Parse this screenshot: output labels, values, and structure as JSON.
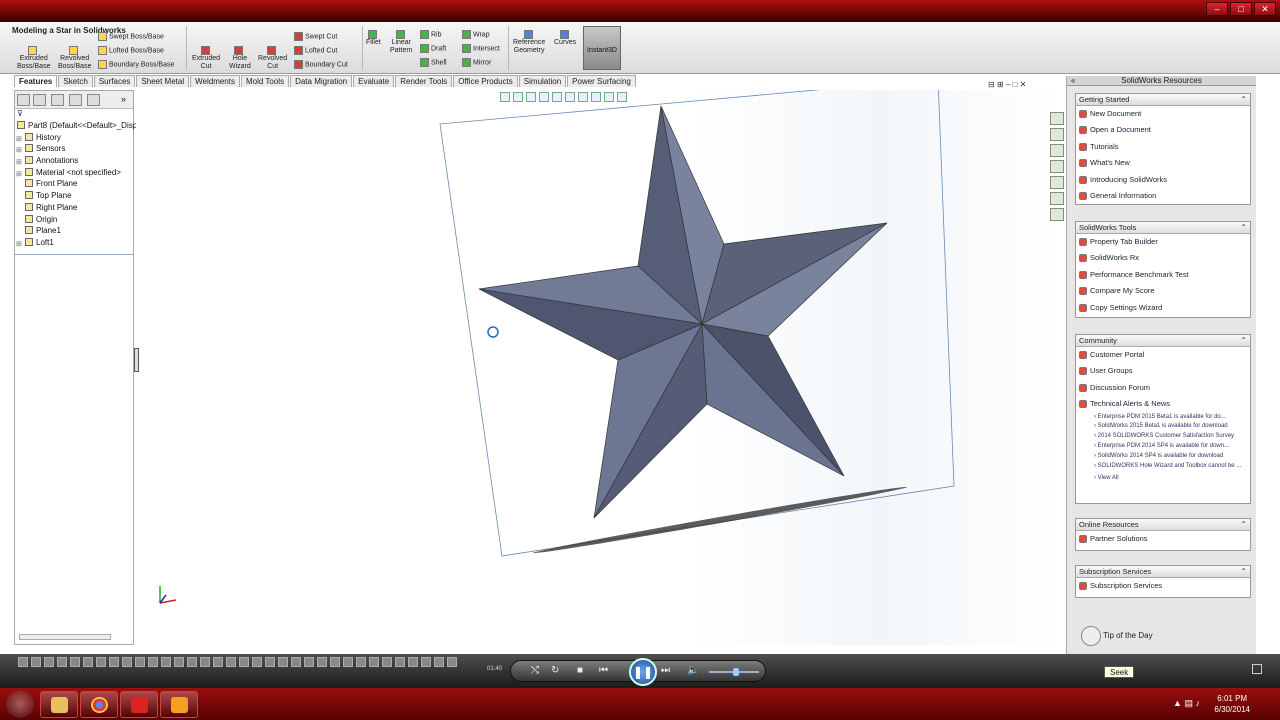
{
  "window": {
    "title": "Modeling a Star in Solidworks",
    "controls": [
      "–",
      "□",
      "✕"
    ]
  },
  "ribbon": {
    "extruded_boss": "Extruded\nBoss/Base",
    "revolved_boss": "Revolved\nBoss/Base",
    "swept_boss": "Swept Boss/Base",
    "lofted_boss": "Lofted Boss/Base",
    "boundary_boss": "Boundary Boss/Base",
    "extruded_cut": "Extruded\nCut",
    "hole_wizard": "Hole\nWizard",
    "revolved_cut": "Revolved\nCut",
    "swept_cut": "Swept Cut",
    "lofted_cut": "Lofted Cut",
    "boundary_cut": "Boundary Cut",
    "fillet": "Fillet",
    "linear_pattern": "Linear\nPattern",
    "rib": "Rib",
    "draft": "Draft",
    "shell": "Shell",
    "wrap": "Wrap",
    "intersect": "Intersect",
    "mirror": "Mirror",
    "reference_geometry": "Reference\nGeometry",
    "curves": "Curves",
    "instant3d": "Instant3D"
  },
  "tabs": [
    "Features",
    "Sketch",
    "Surfaces",
    "Sheet Metal",
    "Weldments",
    "Mold Tools",
    "Data Migration",
    "Evaluate",
    "Render Tools",
    "Office Products",
    "Simulation",
    "Power Surfacing"
  ],
  "tree": {
    "root": "Part8  (Default<<Default>_Disp",
    "items": [
      "History",
      "Sensors",
      "Annotations",
      "Material <not specified>",
      "Front Plane",
      "Top Plane",
      "Right Plane",
      "Origin",
      "Plane1",
      "Loft1"
    ]
  },
  "resources": {
    "header": "SolidWorks Resources",
    "getting_started": {
      "title": "Getting Started",
      "items": [
        "New Document",
        "Open a Document",
        "Tutorials",
        "What's New",
        "Introducing SolidWorks",
        "General Information"
      ]
    },
    "tools": {
      "title": "SolidWorks Tools",
      "items": [
        "Property Tab Builder",
        "SolidWorks Rx",
        "Performance Benchmark Test",
        "Compare My Score",
        "Copy Settings Wizard"
      ]
    },
    "community": {
      "title": "Community",
      "items": [
        "Customer Portal",
        "User Groups",
        "Discussion Forum",
        "Technical Alerts & News"
      ],
      "news": [
        "Enterprise PDM 2015 Beta1 is available for do...",
        "SolidWorks 2015 Beta1 is available for download",
        "2014 SOLIDWORKS Customer Satisfaction Survey",
        "Enterprise PDM 2014 SP4 is available for down...",
        "SolidWorks 2014 SP4 is available for download",
        "SOLIDWORKS Hole Wizard and Toolbox cannot be ..."
      ],
      "view_all": "View All"
    },
    "online": {
      "title": "Online Resources",
      "items": [
        "Partner Solutions"
      ]
    },
    "subscription": {
      "title": "Subscription Services",
      "items": [
        "Subscription Services"
      ]
    },
    "tip": "Tip of the Day"
  },
  "player": {
    "timecode": "01:40",
    "seek_tooltip": "Seek"
  },
  "clock": {
    "time": "6:01 PM",
    "date": "6/30/2014"
  },
  "colors": {
    "star_light": "#6c7590",
    "star_dark": "#4a5068",
    "taskbar": "#8a0a0a"
  }
}
